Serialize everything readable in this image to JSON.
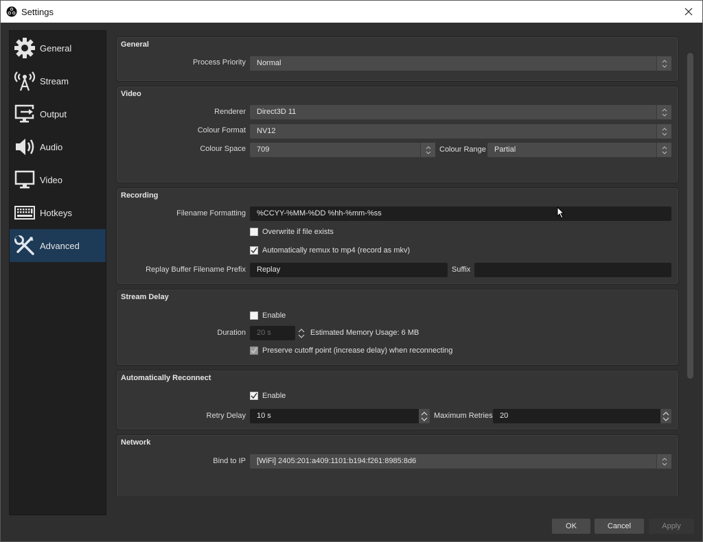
{
  "window": {
    "title": "Settings",
    "app_icon": "obs-logo-icon",
    "close_icon": "close-icon"
  },
  "sidebar": {
    "items": [
      {
        "label": "General",
        "icon": "gear-icon",
        "active": false
      },
      {
        "label": "Stream",
        "icon": "antenna-icon",
        "active": false
      },
      {
        "label": "Output",
        "icon": "output-icon",
        "active": false
      },
      {
        "label": "Audio",
        "icon": "speaker-icon",
        "active": false
      },
      {
        "label": "Video",
        "icon": "monitor-icon",
        "active": false
      },
      {
        "label": "Hotkeys",
        "icon": "keyboard-icon",
        "active": false
      },
      {
        "label": "Advanced",
        "icon": "wrench-screwdriver-icon",
        "active": true
      }
    ]
  },
  "general": {
    "title": "General",
    "process_priority_label": "Process Priority",
    "process_priority_value": "Normal"
  },
  "video": {
    "title": "Video",
    "renderer_label": "Renderer",
    "renderer_value": "Direct3D 11",
    "colour_format_label": "Colour Format",
    "colour_format_value": "NV12",
    "colour_space_label": "Colour Space",
    "colour_space_value": "709",
    "colour_range_label": "Colour Range",
    "colour_range_value": "Partial"
  },
  "recording": {
    "title": "Recording",
    "filename_formatting_label": "Filename Formatting",
    "filename_formatting_value": "%CCYY-%MM-%DD %hh-%mm-%ss",
    "overwrite_label": "Overwrite if file exists",
    "overwrite_checked": false,
    "remux_label": "Automatically remux to mp4 (record as mkv)",
    "remux_checked": true,
    "replay_prefix_label": "Replay Buffer Filename Prefix",
    "replay_prefix_value": "Replay",
    "suffix_label": "Suffix",
    "suffix_value": ""
  },
  "stream_delay": {
    "title": "Stream Delay",
    "enable_label": "Enable",
    "enable_checked": false,
    "duration_label": "Duration",
    "duration_value": "20 s",
    "memory_usage": "Estimated Memory Usage: 6 MB",
    "preserve_label": "Preserve cutoff point (increase delay) when reconnecting",
    "preserve_checked": true
  },
  "auto_reconnect": {
    "title": "Automatically Reconnect",
    "enable_label": "Enable",
    "enable_checked": true,
    "retry_delay_label": "Retry Delay",
    "retry_delay_value": "10 s",
    "max_retries_label": "Maximum Retries",
    "max_retries_value": "20"
  },
  "network": {
    "title": "Network",
    "bind_ip_label": "Bind to IP",
    "bind_ip_value": "[WiFi] 2405:201:a409:1101:b194:f261:8985:8d6"
  },
  "footer": {
    "ok": "OK",
    "cancel": "Cancel",
    "apply": "Apply"
  },
  "colors": {
    "active_nav": "#1d3a56",
    "panel": "#353535",
    "input_dark": "#1e1e1e",
    "combo": "#4a4a4a"
  }
}
